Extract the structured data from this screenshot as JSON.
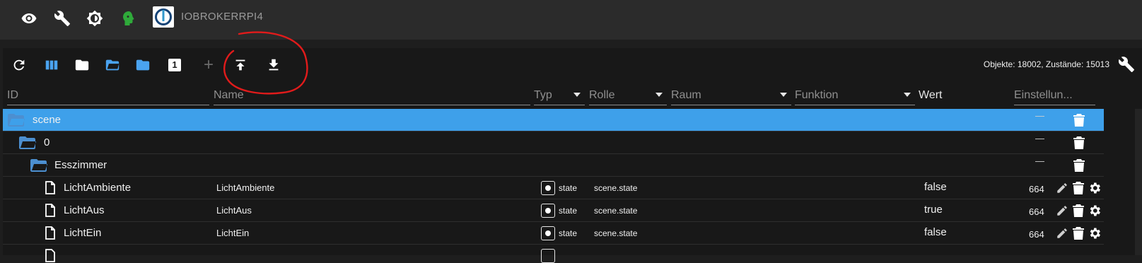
{
  "topbar": {
    "brand_name": "IOBROKERRPI4",
    "icons": [
      "eye-icon",
      "wrench-icon",
      "brightness-icon",
      "user-head-icon"
    ]
  },
  "toolbar": {
    "stats": "Objekte: 18002, Zustände: 15013",
    "columns_badge": "1",
    "add_label": "+"
  },
  "filters": {
    "id": "ID",
    "name": "Name",
    "typ": "Typ",
    "rolle": "Rolle",
    "raum": "Raum",
    "funktion": "Funktion",
    "wert": "Wert",
    "einstellungen": "Einstellun..."
  },
  "colors": {
    "selected_row": "#3ea0ea",
    "folder_blue": "#4c8fd0",
    "annotation_red": "#e11b1b",
    "head_green": "#2faa3a"
  },
  "rows": [
    {
      "kind": "folder",
      "id": "scene",
      "selected": true
    },
    {
      "kind": "folder",
      "id": "0"
    },
    {
      "kind": "folder",
      "id": "Esszimmer"
    },
    {
      "kind": "state",
      "id": "LichtAmbiente",
      "name": "LichtAmbiente",
      "type": "state",
      "role": "scene.state",
      "value": "false",
      "acl": "664"
    },
    {
      "kind": "state",
      "id": "LichtAus",
      "name": "LichtAus",
      "type": "state",
      "role": "scene.state",
      "value": "true",
      "acl": "664"
    },
    {
      "kind": "state",
      "id": "LichtEin",
      "name": "LichtEin",
      "type": "state",
      "role": "scene.state",
      "value": "false",
      "acl": "664"
    }
  ]
}
